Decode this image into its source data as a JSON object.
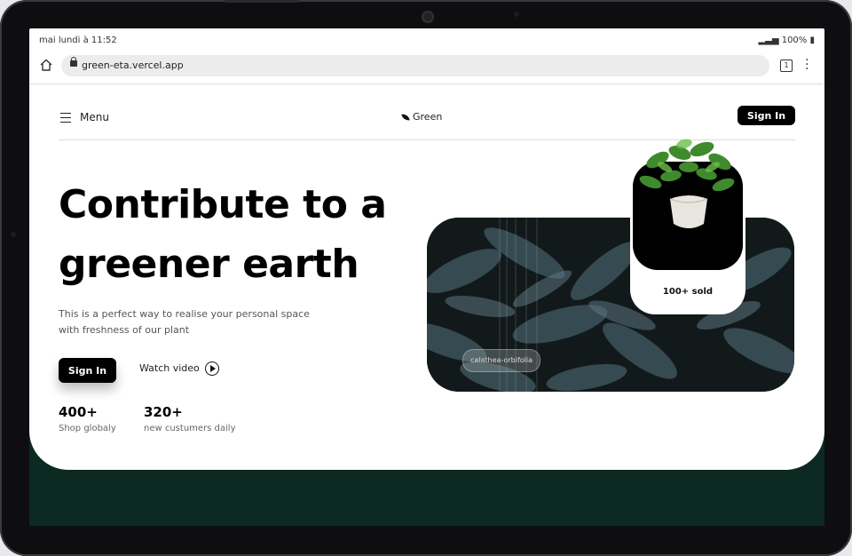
{
  "status": {
    "time": "mai lundi à 11:52",
    "battery": "100%"
  },
  "browser": {
    "url": "green-eta.vercel.app",
    "tab_count": "1"
  },
  "nav": {
    "menu_label": "Menu",
    "brand": "Green",
    "signin_label": "Sign In"
  },
  "hero": {
    "title_line1": "Contribute to a",
    "title_line2": "greener earth",
    "subtitle_line1": "This is a perfect way to realise your personal space",
    "subtitle_line2": "with freshness of our plant",
    "signin_label": "Sign In",
    "watch_label": "Watch video"
  },
  "stats": [
    {
      "num": "400+",
      "label": "Shop globaly"
    },
    {
      "num": "320+",
      "label": "new custumers daily"
    }
  ],
  "image_caption": "calathea-orbifolia",
  "plant_card": {
    "sold": "100+ sold"
  },
  "colors": {
    "accent_dark": "#0c2a21",
    "black": "#000000"
  }
}
